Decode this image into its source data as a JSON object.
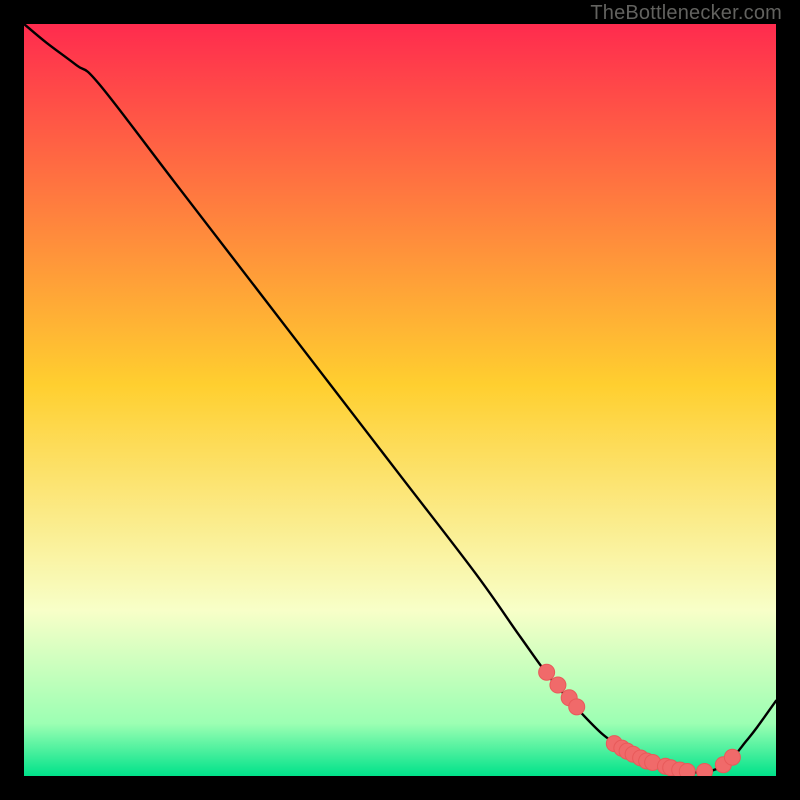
{
  "attribution": "TheBottlenecker.com",
  "colors": {
    "page_bg": "#000000",
    "line": "#000000",
    "marker_fill": "#f06a6a",
    "marker_stroke": "#e85a5a",
    "gradient_top": "#ff2b4e",
    "gradient_mid": "#ffcf2f",
    "gradient_band_light": "#f8ffc8",
    "gradient_near_bottom": "#9cffb3",
    "gradient_bottom": "#00e28a"
  },
  "chart_data": {
    "type": "line",
    "title": "",
    "xlabel": "",
    "ylabel": "",
    "xlim": [
      0,
      100
    ],
    "ylim": [
      0,
      100
    ],
    "grid": false,
    "legend": false,
    "series": [
      {
        "name": "curve",
        "x": [
          0,
          3,
          7,
          10,
          20,
          30,
          40,
          50,
          60,
          66,
          70,
          74,
          77,
          79.5,
          82,
          85,
          88,
          90,
          92,
          94,
          96,
          97.5,
          100
        ],
        "y": [
          100,
          97.5,
          94.5,
          92,
          79,
          66,
          53,
          40,
          27,
          18.5,
          13,
          8.5,
          5.5,
          3.8,
          2.4,
          1.3,
          0.6,
          0.5,
          0.9,
          2.2,
          4.6,
          6.5,
          10
        ]
      }
    ],
    "markers": {
      "name": "highlighted-points",
      "x": [
        69.5,
        71,
        72.5,
        73.5,
        78.5,
        79.5,
        80.2,
        81,
        82,
        82.8,
        83.6,
        85.3,
        86,
        87.2,
        88.2,
        90.5,
        93,
        94.2
      ],
      "y": [
        13.8,
        12.1,
        10.4,
        9.2,
        4.3,
        3.7,
        3.3,
        2.9,
        2.4,
        2.0,
        1.8,
        1.3,
        1.1,
        0.8,
        0.6,
        0.6,
        1.5,
        2.5
      ]
    }
  }
}
